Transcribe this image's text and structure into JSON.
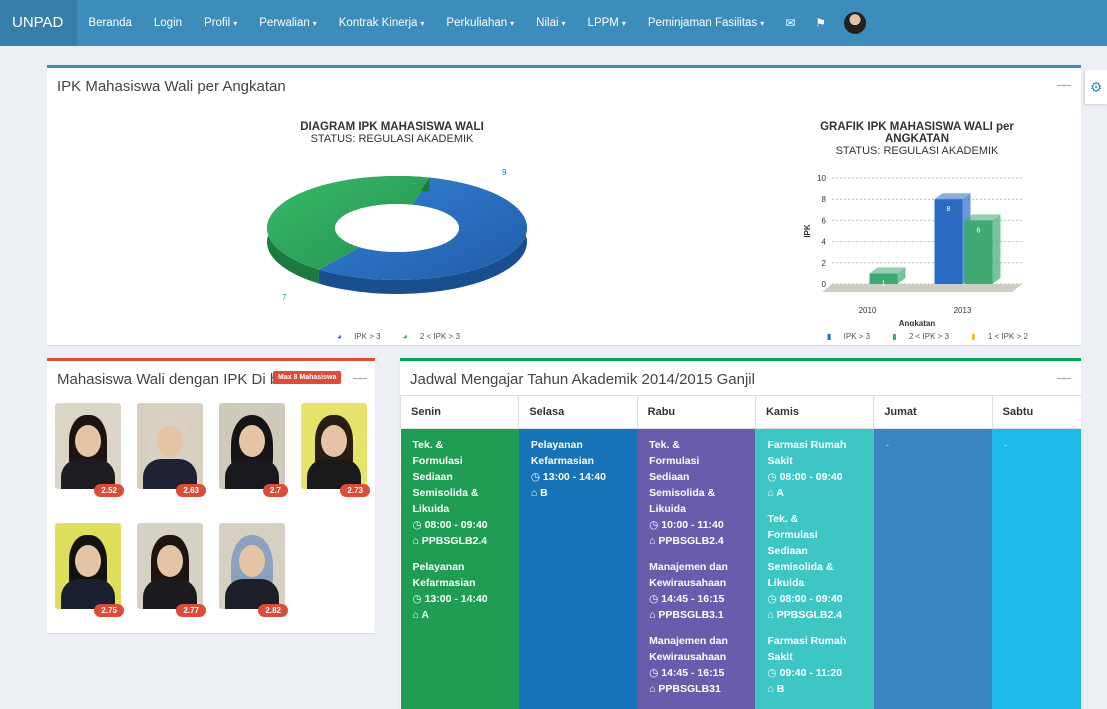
{
  "nav": {
    "brand": "UNPAD",
    "items": [
      {
        "label": "Beranda",
        "dropdown": false
      },
      {
        "label": "Login",
        "dropdown": false
      },
      {
        "label": "Profil",
        "dropdown": true
      },
      {
        "label": "Perwalian",
        "dropdown": true
      },
      {
        "label": "Kontrak Kinerja",
        "dropdown": true
      },
      {
        "label": "Perkuliahan",
        "dropdown": true
      },
      {
        "label": "Nilai",
        "dropdown": true
      },
      {
        "label": "LPPM",
        "dropdown": true
      },
      {
        "label": "Peminjaman Fasilitas",
        "dropdown": true
      }
    ],
    "caret": "▾",
    "mail_icon": "✉",
    "flag_icon": "⚑"
  },
  "ipk_box": {
    "title": "IPK Mahasiswa Wali per Angkatan",
    "collapse": "—",
    "donut": {
      "title": "DIAGRAM IPK MAHASISWA WALI",
      "subtitle": "STATUS: REGULASI AKADEMIK",
      "label_blue": "9",
      "label_green": "7",
      "legend_1": "IPK > 3",
      "legend_2": "2 < IPK > 3"
    },
    "bar": {
      "title_line1": "GRAFIK IPK MAHASISWA WALI per",
      "title_line2": "ANGKATAN",
      "subtitle": "STATUS: REGULASI AKADEMIK",
      "ylabel": "IPK",
      "xlabel": "Angkatan",
      "legend_1": "IPK > 3",
      "legend_2": "2 < IPK > 3",
      "legend_3": "1 < IPK > 2"
    }
  },
  "chart_data": [
    {
      "type": "pie",
      "title": "DIAGRAM IPK MAHASISWA WALI",
      "subtitle": "STATUS: REGULASI AKADEMIK",
      "categories": [
        "IPK > 3",
        "2 < IPK > 3"
      ],
      "values": [
        9,
        7
      ],
      "colors": [
        "#2a6cc4",
        "#2ca55a"
      ]
    },
    {
      "type": "bar",
      "title": "GRAFIK IPK MAHASISWA WALI per ANGKATAN",
      "subtitle": "STATUS: REGULASI AKADEMIK",
      "xlabel": "Angkatan",
      "ylabel": "IPK",
      "ylim": [
        0,
        10
      ],
      "yticks": [
        0,
        2,
        4,
        6,
        8,
        10
      ],
      "categories": [
        "2010",
        "2013"
      ],
      "series": [
        {
          "name": "IPK > 3",
          "values": [
            0,
            8
          ],
          "color": "#2a6cc4"
        },
        {
          "name": "2 < IPK > 3",
          "values": [
            1,
            6
          ],
          "color": "#3fa873"
        },
        {
          "name": "1 < IPK > 2",
          "values": [
            0,
            0
          ],
          "color": "#e8c01f"
        }
      ]
    }
  ],
  "wali_box": {
    "title": "Mahasiswa Wali dengan IPK Di baw",
    "badge": "Max 8 Mahasiswa",
    "collapse": "—",
    "students": [
      {
        "ipk": "2.52",
        "bg": "#d9d6c8",
        "hair": "#1b1410",
        "body": "#1d1d22",
        "hijab": false
      },
      {
        "ipk": "2.63",
        "bg": "#d7cfc0",
        "hair": "#d9d2c4",
        "body": "#1e2233",
        "hijab": true
      },
      {
        "ipk": "2.7",
        "bg": "#cfc9bb",
        "hair": "#151515",
        "body": "#181a20",
        "hijab": true
      },
      {
        "ipk": "2.73",
        "bg": "#e6e36a",
        "hair": "#2a1d15",
        "body": "#1a1a1c",
        "hijab": false
      },
      {
        "ipk": "2.75",
        "bg": "#dede5a",
        "hair": "#141210",
        "body": "#1a2030",
        "hijab": false
      },
      {
        "ipk": "2.77",
        "bg": "#d5d1c4",
        "hair": "#1c1511",
        "body": "#1b1b1f",
        "hijab": false
      },
      {
        "ipk": "2.82",
        "bg": "#d6d0c2",
        "hair": "#8aa2c0",
        "body": "#1d2028",
        "hijab": true
      }
    ]
  },
  "jadwal_box": {
    "title": "Jadwal Mengajar Tahun Akademik 2014/2015 Ganjil",
    "collapse": "—",
    "days": [
      "Senin",
      "Selasa",
      "Rabu",
      "Kamis",
      "Jumat",
      "Sabtu"
    ],
    "colors": [
      "#1f9d55",
      "#1773b8",
      "#6a5cad",
      "#3ec6c4",
      "#3a85bf",
      "#1ebbe9"
    ],
    "cells": [
      [
        {
          "lines": [
            "Tek. &",
            "Formulasi",
            "Sediaan",
            "Semisolida &",
            "Likuida"
          ],
          "time": "08:00 - 09:40",
          "room": "PPBSGLB2.4"
        },
        {
          "lines": [
            "Pelayanan",
            "Kefarmasian"
          ],
          "time": "13:00 - 14:40",
          "room": "A"
        }
      ],
      [
        {
          "lines": [
            "Pelayanan",
            "Kefarmasian"
          ],
          "time": "13:00 - 14:40",
          "room": "B"
        }
      ],
      [
        {
          "lines": [
            "Tek. &",
            "Formulasi",
            "Sediaan",
            "Semisolida &",
            "Likuida"
          ],
          "time": "10:00 - 11:40",
          "room": "PPBSGLB2.4"
        },
        {
          "lines": [
            "Manajemen dan",
            "Kewirausahaan"
          ],
          "time": "14:45 - 16:15",
          "room": "PPBSGLB3.1"
        },
        {
          "lines": [
            "Manajemen dan",
            "Kewirausahaan"
          ],
          "time": "14:45 - 16:15",
          "room": "PPBSGLB31"
        }
      ],
      [
        {
          "lines": [
            "Farmasi Rumah",
            "Sakit"
          ],
          "time": "08:00 - 09:40",
          "room": "A"
        },
        {
          "lines": [
            "Tek. &",
            "Formulasi",
            "Sediaan",
            "Semisolida &",
            "Likuida"
          ],
          "time": "08:00 - 09:40",
          "room": "PPBSGLB2.4"
        },
        {
          "lines": [
            "Farmasi Rumah",
            "Sakit"
          ],
          "time": "09:40 - 11:20",
          "room": "B"
        }
      ],
      [],
      []
    ],
    "empty_mark": "-",
    "clock_icon": "◷",
    "room_icon": "⌂"
  },
  "settings_icon": "⚙"
}
